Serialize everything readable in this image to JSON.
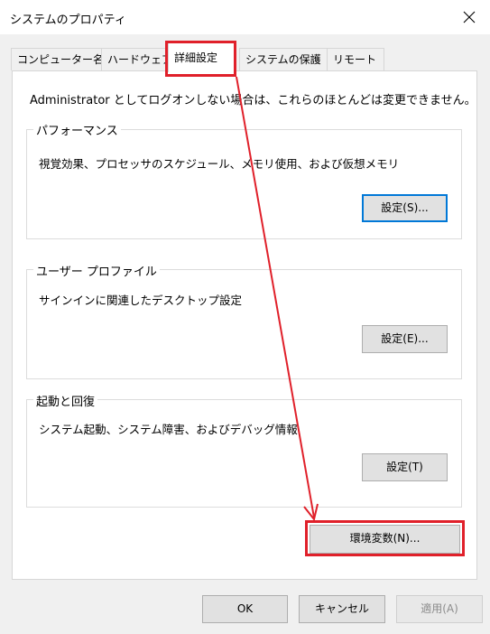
{
  "window": {
    "title": "システムのプロパティ"
  },
  "tabs": [
    {
      "label": "コンピューター名"
    },
    {
      "label": "ハードウェア"
    },
    {
      "label": "詳細設定"
    },
    {
      "label": "システムの保護"
    },
    {
      "label": "リモート"
    }
  ],
  "intro_text": "Administrator としてログオンしない場合は、これらのほとんどは変更できません。",
  "groups": {
    "performance": {
      "title": "パフォーマンス",
      "desc": "視覚効果、プロセッサのスケジュール、メモリ使用、および仮想メモリ",
      "button": "設定(S)..."
    },
    "user_profile": {
      "title": "ユーザー プロファイル",
      "desc": "サインインに関連したデスクトップ設定",
      "button": "設定(E)..."
    },
    "startup": {
      "title": "起動と回復",
      "desc": "システム起動、システム障害、およびデバッグ情報",
      "button": "設定(T)"
    }
  },
  "env_button": "環境変数(N)...",
  "footer": {
    "ok": "OK",
    "cancel": "キャンセル",
    "apply": "適用(A)"
  },
  "colors": {
    "annotation": "#e0202a",
    "focus": "#0078d7"
  }
}
